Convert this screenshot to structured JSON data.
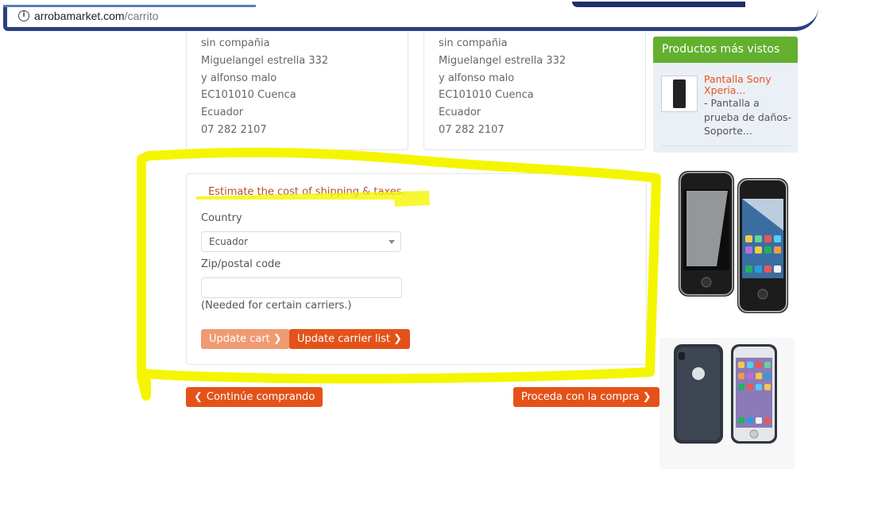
{
  "browser": {
    "domain": "arrobamarket.com",
    "path": "/carrito",
    "info_icon": "info-icon"
  },
  "addresses": [
    {
      "lines": [
        "sin compañia",
        "Miguelangel estrella 332",
        "y alfonso malo",
        "EC101010 Cuenca",
        "Ecuador",
        "07 282 2107"
      ]
    },
    {
      "lines": [
        "sin compañia",
        "Miguelangel estrella 332",
        "y alfonso malo",
        "EC101010 Cuenca",
        "Ecuador",
        "07 282 2107"
      ]
    }
  ],
  "sidebar": {
    "heading": "Productos más vistos",
    "product": {
      "title": "Pantalla Sony Xperia...",
      "description": "- Pantalla a prueba de daños-Soporte..."
    }
  },
  "shipping": {
    "title": "Estimate the cost of shipping & taxes.",
    "country_label": "Country",
    "country_value": "Ecuador",
    "zip_label": "Zip/postal code",
    "zip_value": "",
    "note": "(Needed for certain carriers.)",
    "update_cart": "Update cart",
    "update_carrier": "Update carrier list"
  },
  "actions": {
    "continue": "Continúe comprando",
    "proceed": "Proceda con la compra"
  },
  "colors": {
    "accent": "#e4521a",
    "sidebar_header": "#63b02e",
    "highlight": "#f5f500"
  }
}
